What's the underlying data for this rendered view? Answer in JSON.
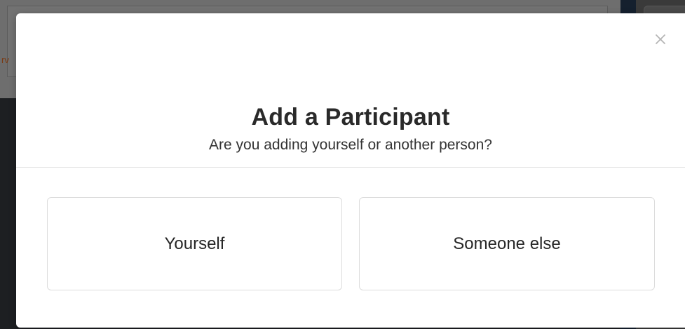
{
  "background": {
    "partial_text": "rv"
  },
  "modal": {
    "title": "Add a Participant",
    "subtitle": "Are you adding yourself or another person?",
    "close_icon": "close-icon",
    "options": [
      {
        "label": "Yourself"
      },
      {
        "label": "Someone else"
      }
    ]
  },
  "colors": {
    "overlay": "#2b2b2b",
    "modal_bg": "#ffffff",
    "card_border": "#dcdcdc",
    "title_text": "#2a2a2a",
    "close_icon": "#b5b5b5"
  }
}
